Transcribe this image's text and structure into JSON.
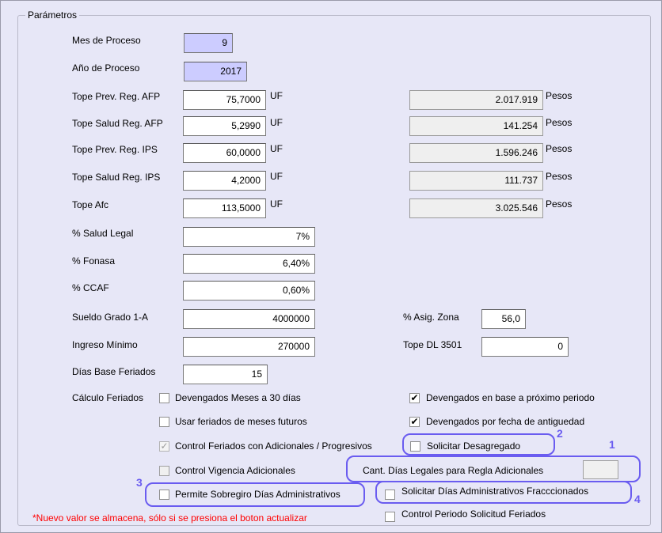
{
  "group_title": "Parámetros",
  "params": {
    "mes_label": "Mes de Proceso",
    "mes_value": "9",
    "anio_label": "Año de Proceso",
    "anio_value": "2017",
    "tope_prev_afp_label": "Tope Prev. Reg. AFP",
    "tope_prev_afp_value": "75,7000",
    "tope_prev_afp_pesos": "2.017.919",
    "tope_salud_afp_label": "Tope Salud Reg. AFP",
    "tope_salud_afp_value": "5,2990",
    "tope_salud_afp_pesos": "141.254",
    "tope_prev_ips_label": "Tope Prev. Reg. IPS",
    "tope_prev_ips_value": "60,0000",
    "tope_prev_ips_pesos": "1.596.246",
    "tope_salud_ips_label": "Tope Salud Reg. IPS",
    "tope_salud_ips_value": "4,2000",
    "tope_salud_ips_pesos": "111.737",
    "tope_afc_label": "Tope Afc",
    "tope_afc_value": "113,5000",
    "tope_afc_pesos": "3.025.546",
    "unit_uf": "UF",
    "unit_pesos": "Pesos",
    "salud_legal_label": "% Salud Legal",
    "salud_legal_value": "7%",
    "fonasa_label": "% Fonasa",
    "fonasa_value": "6,40%",
    "ccaf_label": "% CCAF",
    "ccaf_value": "0,60%",
    "sueldo_label": "Sueldo Grado 1-A",
    "sueldo_value": "4000000",
    "ingreso_label": "Ingreso Mínimo",
    "ingreso_value": "270000",
    "dias_base_label": "Días Base Feriados",
    "dias_base_value": "15",
    "asig_zona_label": "% Asig. Zona",
    "asig_zona_value": "56,0",
    "tope_dl_label": "Tope DL 3501",
    "tope_dl_value": "0"
  },
  "feriados": {
    "section_label": "Cálculo Feriados",
    "devengados_30": "Devengados Meses a 30 días",
    "usar_futuros": "Usar feriados de meses futuros",
    "control_adicionales": "Control Feriados con Adicionales / Progresivos",
    "control_vigencia": "Control Vigencia Adicionales",
    "permite_sobregiro": "Permite Sobregiro Días Administrativos",
    "devengados_proximo": "Devengados en base a próximo periodo",
    "devengados_antiguedad": "Devengados por fecha de antiguedad",
    "solicitar_desagregado": "Solicitar Desagregado",
    "cant_dias_legales": "Cant. Días Legales para Regla Adicionales",
    "solicitar_fraccionados": "Solicitar Días Administrativos Fracccionados",
    "control_periodo": "Control Periodo Solicitud Feriados"
  },
  "note": "*Nuevo valor se almacena, sólo si se presiona el boton actualizar",
  "annotations": {
    "n1": "1",
    "n2": "2",
    "n3": "3",
    "n4": "4"
  },
  "colors": {
    "background": "#e7e7f7",
    "highlight": "#6a5cf0",
    "note": "#ff0000",
    "blue_input": "#ccccff"
  }
}
